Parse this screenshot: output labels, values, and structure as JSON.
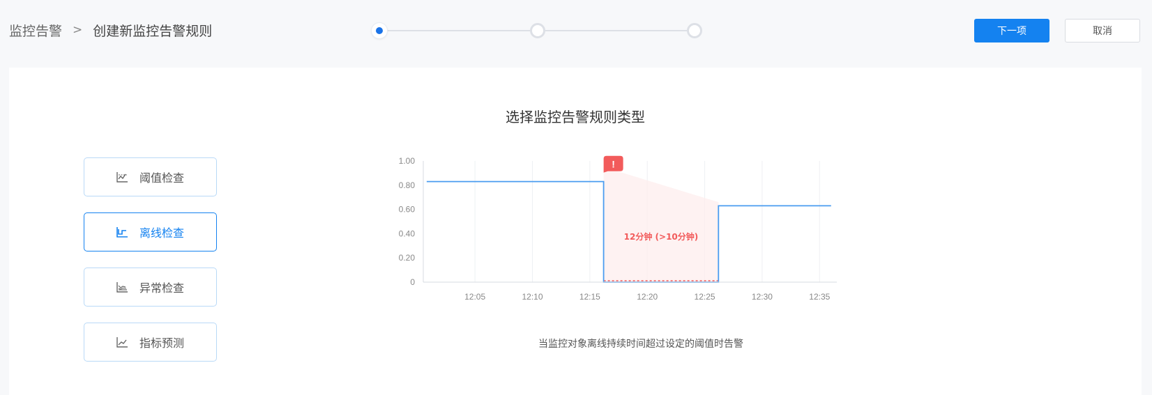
{
  "breadcrumb": {
    "root": "监控告警",
    "separator": ">",
    "current": "创建新监控告警规则"
  },
  "steps": {
    "count": 3,
    "active_index": 0
  },
  "actions": {
    "next_label": "下一项",
    "cancel_label": "取消"
  },
  "panel": {
    "title": "选择监控告警规则类型",
    "types": [
      {
        "label": "阈值检查",
        "icon": "threshold-chart-icon",
        "selected": false
      },
      {
        "label": "离线检查",
        "icon": "offline-chart-icon",
        "selected": true
      },
      {
        "label": "异常检查",
        "icon": "anomaly-chart-icon",
        "selected": false
      },
      {
        "label": "指标预测",
        "icon": "forecast-chart-icon",
        "selected": false
      }
    ],
    "caption": "当监控对象离线持续时间超过设定的阈值时告警"
  },
  "colors": {
    "accent": "#1482f0",
    "line": "#4a9cf0",
    "alert": "#f25b5b",
    "alert_fill": "#fdeeee"
  },
  "chart_data": {
    "type": "line",
    "x_ticks": [
      "12:05",
      "12:10",
      "12:15",
      "12:20",
      "12:25",
      "12:30",
      "12:35"
    ],
    "y_ticks": [
      "1.00",
      "0.80",
      "0.60",
      "0.40",
      "0.20",
      "0"
    ],
    "ylim": [
      0,
      1
    ],
    "xlim_minutes": [
      0.5,
      36.5
    ],
    "series": [
      {
        "points": [
          [
            0.8,
            0.83
          ],
          [
            16.2,
            0.83
          ],
          [
            16.2,
            0
          ],
          [
            26.2,
            0
          ],
          [
            26.2,
            0.63
          ],
          [
            36.0,
            0.63
          ]
        ]
      }
    ],
    "alert_annotation": {
      "label": "12分钟 (>10分钟)",
      "marker": "!",
      "start_minute": 16.2,
      "end_minute": 26.2
    },
    "grid": true
  }
}
